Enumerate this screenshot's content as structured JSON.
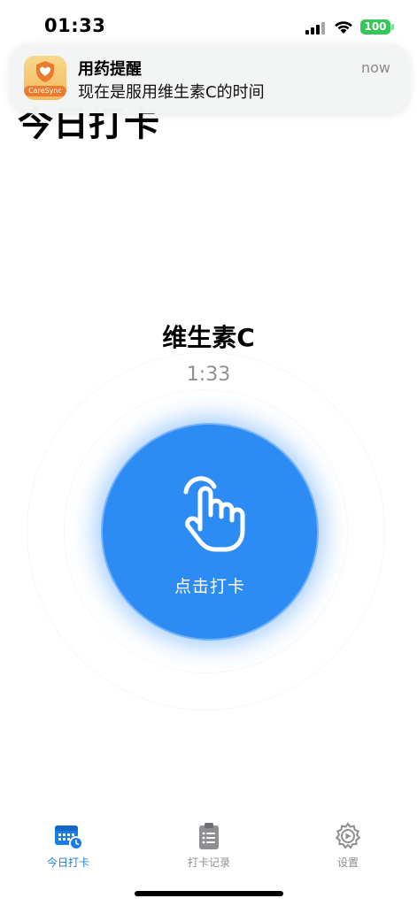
{
  "status_bar": {
    "time": "01:33",
    "battery": "100",
    "battery_color": "#34c759"
  },
  "page": {
    "title": "今日打卡"
  },
  "notification": {
    "app_icon": "caresync-app-icon",
    "app_icon_text": "CareSync",
    "title": "用药提醒",
    "body": "现在是服用维生素C的时间",
    "time": "now"
  },
  "medication": {
    "name": "维生素C",
    "time": "1:33"
  },
  "checkin": {
    "label": "点击打卡",
    "icon": "tap-hand-icon",
    "color": "#2d8cf4"
  },
  "tabs": [
    {
      "label": "今日打卡",
      "icon": "calendar-clock-icon",
      "active": true
    },
    {
      "label": "打卡记录",
      "icon": "clipboard-list-icon",
      "active": false
    },
    {
      "label": "设置",
      "icon": "gear-icon",
      "active": false
    }
  ],
  "colors": {
    "accent": "#1a7de6",
    "inactive": "#8e8e93"
  }
}
